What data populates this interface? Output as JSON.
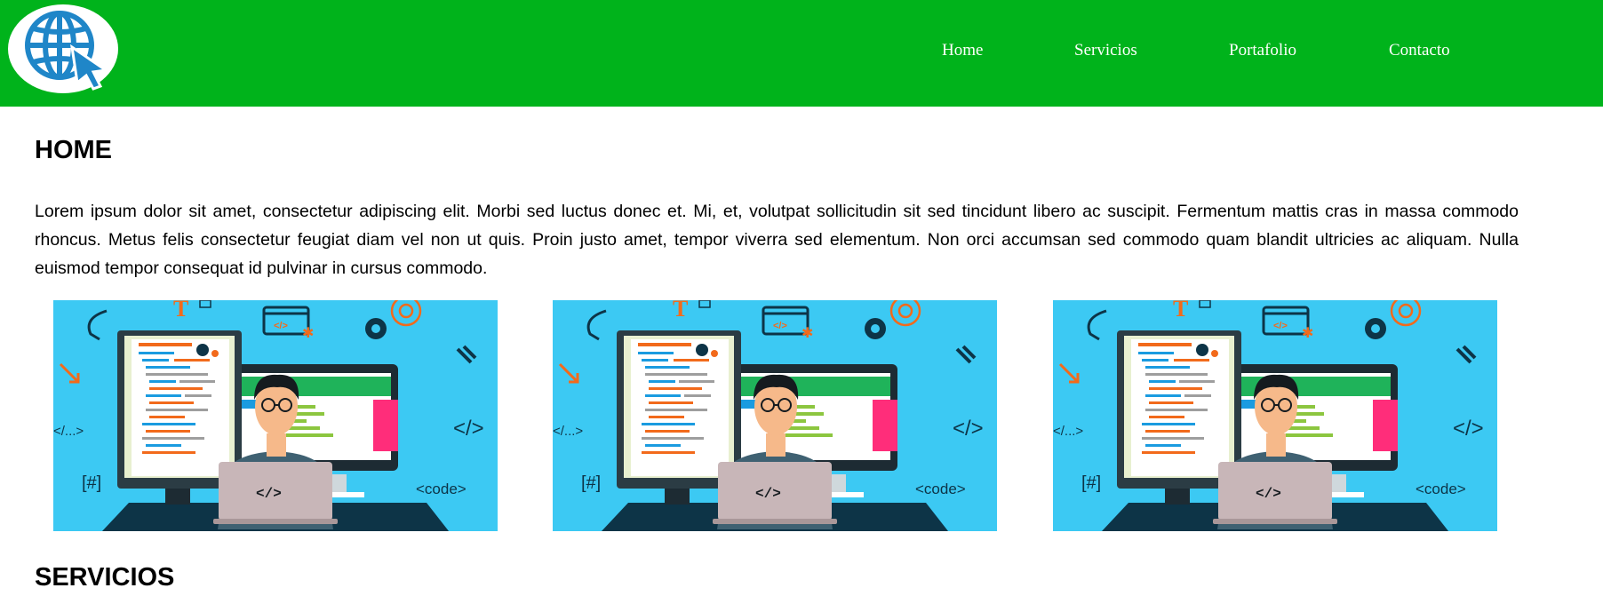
{
  "header": {
    "background": "#00b31b",
    "logo_icon": "globe-cursor-icon",
    "nav": [
      {
        "label": "Home"
      },
      {
        "label": "Servicios"
      },
      {
        "label": "Portafolio"
      },
      {
        "label": "Contacto"
      }
    ]
  },
  "home": {
    "title": "HOME",
    "text": "Lorem ipsum dolor sit amet, consectetur adipiscing elit. Morbi sed luctus donec et. Mi, et, volutpat sollicitudin sit sed tincidunt libero ac suscipit. Fermentum mattis cras in massa commodo rhoncus. Metus felis consectetur feugiat diam vel non ut quis. Proin justo amet, tempor viverra sed elementum. Non orci accumsan sed commodo quam blandit ultricies ac aliquam. Nulla euismod tempor consequat id pulvinar in cursus commodo.",
    "images": [
      {
        "icon": "developer-illustration",
        "labels": {
          "tag_left": "</...>",
          "tag_right": "</>",
          "hash": "[#]",
          "code": "<code>",
          "laptop": "</>",
          "window": "</>",
          "letter": "T"
        }
      },
      {
        "icon": "developer-illustration",
        "labels": {
          "tag_left": "</...>",
          "tag_right": "</>",
          "hash": "[#]",
          "code": "<code>",
          "laptop": "</>",
          "window": "</>",
          "letter": "T"
        }
      },
      {
        "icon": "developer-illustration",
        "labels": {
          "tag_left": "</...>",
          "tag_right": "</>",
          "hash": "[#]",
          "code": "<code>",
          "laptop": "</>",
          "window": "</>",
          "letter": "T"
        }
      }
    ]
  },
  "servicios": {
    "title": "SERVICIOS"
  },
  "colors": {
    "illustration_bg": "#3cc9f3",
    "accent_orange": "#f26a1b",
    "dark_navy": "#0d3447"
  }
}
